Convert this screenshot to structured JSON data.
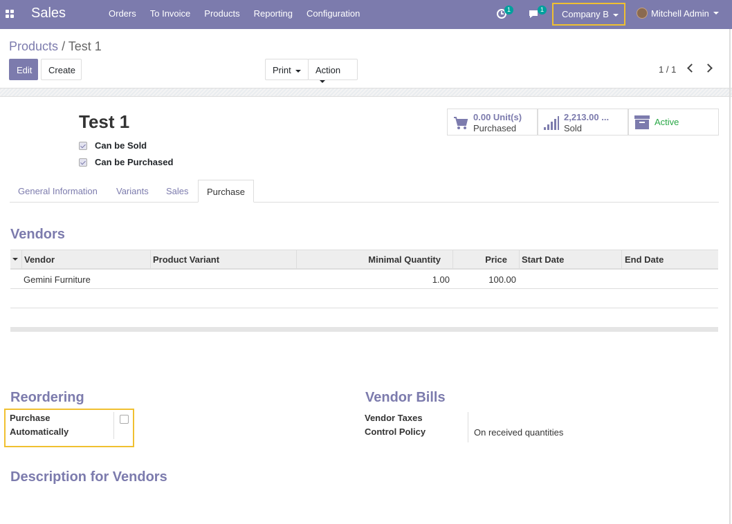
{
  "topbar": {
    "app_name": "Sales",
    "menu": [
      "Orders",
      "To Invoice",
      "Products",
      "Reporting",
      "Configuration"
    ],
    "activity_count": "1",
    "messages_count": "1",
    "company": "Company B",
    "user": "Mitchell Admin",
    "brand_color": "#7c7bad",
    "highlight_color": "#f0c030"
  },
  "breadcrumb": {
    "parent": "Products",
    "current": "Test 1"
  },
  "buttons": {
    "edit": "Edit",
    "create": "Create",
    "print": "Print",
    "action": "Action"
  },
  "pager": {
    "text": "1 / 1"
  },
  "product": {
    "name": "Test 1",
    "can_be_sold": "Can be Sold",
    "can_be_purchased": "Can be Purchased"
  },
  "stats": {
    "purchased_value": "0.00 Unit(s)",
    "purchased_label": "Purchased",
    "sold_value": "2,213.00 ...",
    "sold_label": "Sold",
    "active_label": "Active",
    "active_color": "#28a745"
  },
  "tabs": [
    "General Information",
    "Variants",
    "Sales",
    "Purchase"
  ],
  "vendors": {
    "title": "Vendors",
    "columns": [
      "Vendor",
      "Product Variant",
      "Minimal Quantity",
      "Price",
      "Start Date",
      "End Date"
    ],
    "rows": [
      {
        "vendor": "Gemini Furniture",
        "variant": "",
        "min_qty": "1.00",
        "price": "100.00",
        "start": "",
        "end": ""
      }
    ]
  },
  "reordering": {
    "title": "Reordering",
    "purchase_label_1": "Purchase",
    "purchase_label_2": "Automatically"
  },
  "vendor_bills": {
    "title": "Vendor Bills",
    "taxes_label": "Vendor Taxes",
    "control_label": "Control Policy",
    "control_value": "On received quantities"
  },
  "description": {
    "title": "Description for Vendors"
  }
}
